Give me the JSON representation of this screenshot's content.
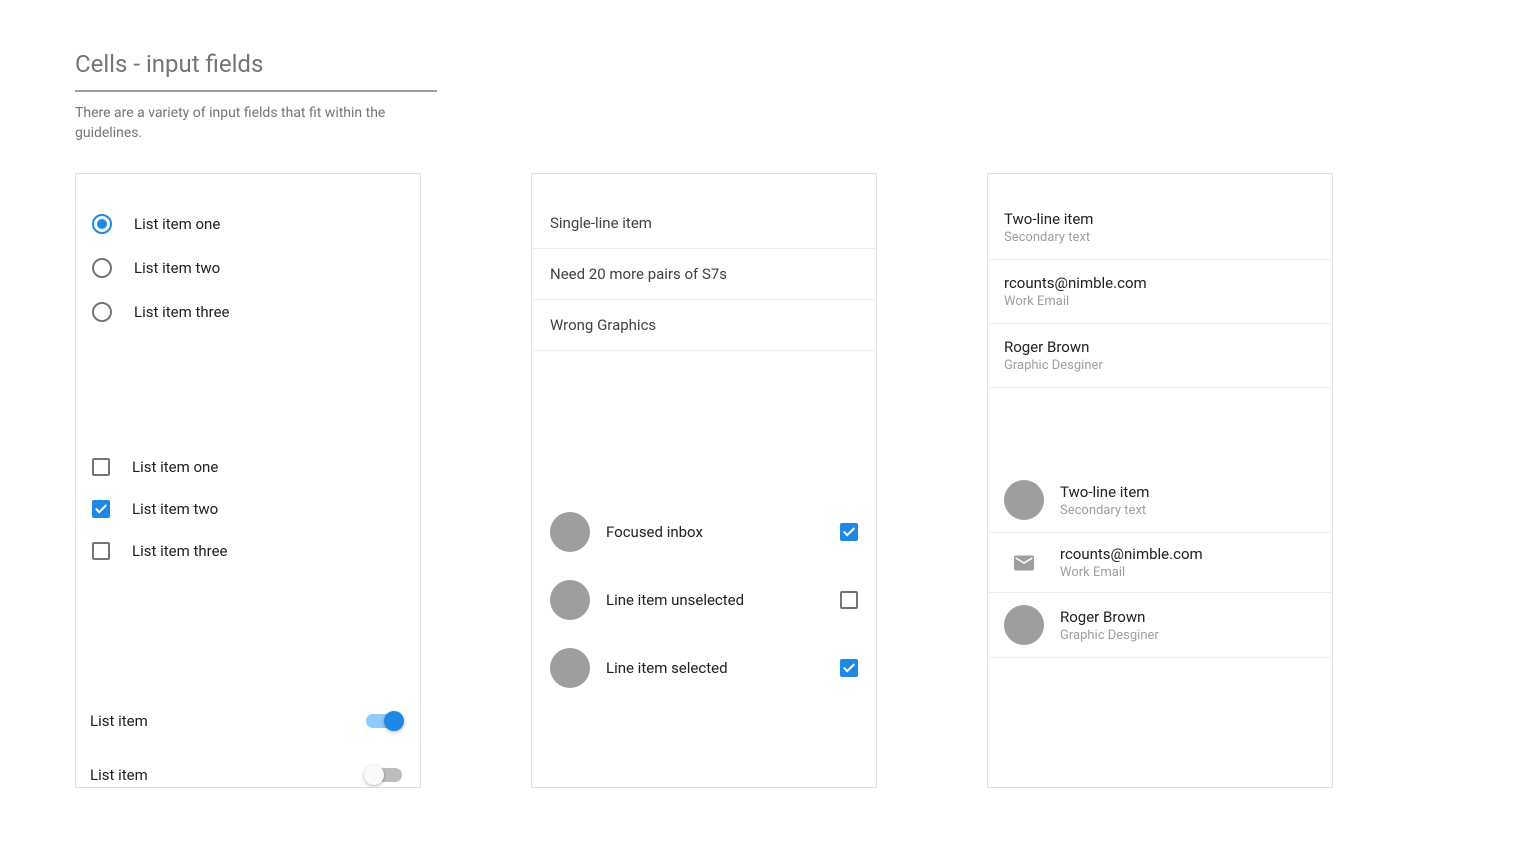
{
  "page": {
    "title": "Cells - input fields",
    "description": "There are a variety of input fields that fit within the guidelines."
  },
  "card1": {
    "radios": [
      {
        "label": "List item one",
        "selected": true
      },
      {
        "label": "List item two",
        "selected": false
      },
      {
        "label": "List item three",
        "selected": false
      }
    ],
    "checkboxes": [
      {
        "label": "List item one",
        "selected": false
      },
      {
        "label": "List item two",
        "selected": true
      },
      {
        "label": "List item three",
        "selected": false
      }
    ],
    "switches": [
      {
        "label": "List item",
        "on": true
      },
      {
        "label": "List item",
        "on": false
      }
    ]
  },
  "card2": {
    "lines": [
      "Single-line item",
      "Need 20 more pairs of S7s",
      "Wrong Graphics"
    ],
    "avatarItems": [
      {
        "label": "Focused inbox",
        "checked": true
      },
      {
        "label": "Line item unselected",
        "checked": false
      },
      {
        "label": "Line item selected",
        "checked": true
      }
    ]
  },
  "card3": {
    "topItems": [
      {
        "primary": "Two-line item",
        "secondary": "Secondary text"
      },
      {
        "primary": "rcounts@nimble.com",
        "secondary": "Work Email"
      },
      {
        "primary": "Roger Brown",
        "secondary": "Graphic Desginer"
      }
    ],
    "bottomItems": [
      {
        "icon": "avatar",
        "primary": "Two-line item",
        "secondary": "Secondary text"
      },
      {
        "icon": "mail",
        "primary": "rcounts@nimble.com",
        "secondary": "Work Email"
      },
      {
        "icon": "avatar",
        "primary": "Roger Brown",
        "secondary": "Graphic Desginer"
      }
    ]
  }
}
